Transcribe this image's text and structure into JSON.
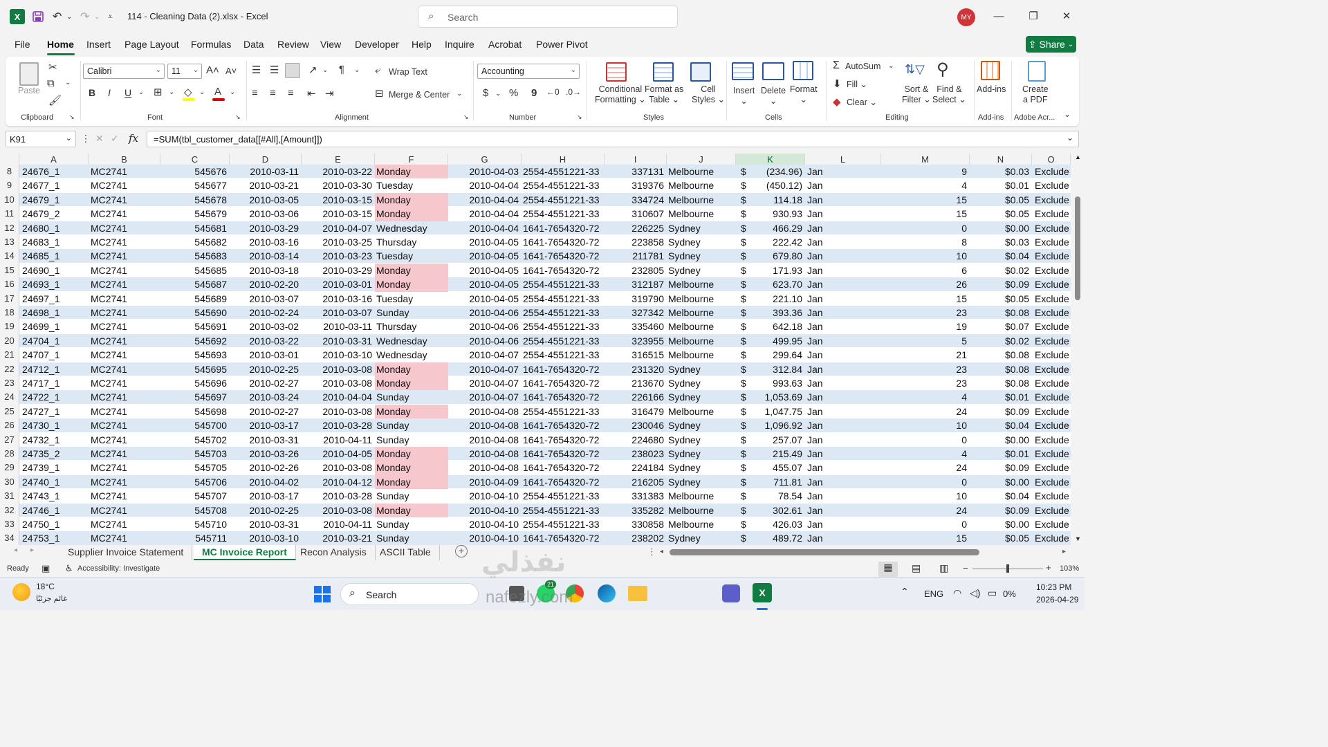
{
  "app": {
    "file_title": "114 - Cleaning Data (2).xlsx  -  Excel",
    "search_placeholder": "Search",
    "avatar": "MY",
    "logo": "X"
  },
  "menu_tabs": [
    "File",
    "Home",
    "Insert",
    "Page Layout",
    "Formulas",
    "Data",
    "Review",
    "View",
    "Developer",
    "Help",
    "Inquire",
    "Acrobat",
    "Power Pivot"
  ],
  "share_label": "Share",
  "ribbon": {
    "clipboard": {
      "label": "Clipboard",
      "paste": "Paste"
    },
    "font": {
      "label": "Font",
      "name": "Calibri",
      "size": "11",
      "bold": "B",
      "italic": "I",
      "underline": "U"
    },
    "alignment": {
      "label": "Alignment",
      "wrap": "Wrap Text",
      "merge": "Merge & Center"
    },
    "number": {
      "label": "Number",
      "format": "Accounting",
      "dollar": "$",
      "percent": "%",
      "comma": "9"
    },
    "styles": {
      "label": "Styles",
      "conditional_1": "Conditional",
      "conditional_2": "Formatting",
      "format_table_1": "Format as",
      "format_table_2": "Table",
      "cell_styles_1": "Cell",
      "cell_styles_2": "Styles"
    },
    "cells": {
      "label": "Cells",
      "insert": "Insert",
      "delete": "Delete",
      "format": "Format"
    },
    "editing": {
      "label": "Editing",
      "autosum": "AutoSum",
      "fill": "Fill",
      "clear": "Clear",
      "sort_1": "Sort &",
      "sort_2": "Filter",
      "find_1": "Find &",
      "find_2": "Select"
    },
    "addins": {
      "label": "Add-ins",
      "btn": "Add-ins"
    },
    "adobe": {
      "label": "Adobe Acr...",
      "btn_1": "Create",
      "btn_2": "a PDF"
    }
  },
  "formula_bar": {
    "name_box": "K91",
    "fx": "fx",
    "formula": "=SUM(tbl_customer_data[[#All],[Amount]])"
  },
  "columns": [
    "A",
    "B",
    "C",
    "D",
    "E",
    "F",
    "G",
    "H",
    "I",
    "J",
    "K",
    "L",
    "M",
    "N",
    "O"
  ],
  "selected_column": "K",
  "rows": [
    {
      "n": "8",
      "a": "24676_1",
      "b": "MC2741",
      "c": "545676",
      "d": "2010-03-11",
      "e": "2010-03-22",
      "f": "Monday",
      "g": "2010-04-03",
      "h": "2554-4551221-33",
      "i": "337131",
      "j": "Melbourne",
      "ks": "$",
      "k": "(234.96)",
      "l": "Jan",
      "m": "9",
      "nn": "$0.03",
      "o": "Exclude"
    },
    {
      "n": "9",
      "a": "24677_1",
      "b": "MC2741",
      "c": "545677",
      "d": "2010-03-21",
      "e": "2010-03-30",
      "f": "Tuesday",
      "g": "2010-04-04",
      "h": "2554-4551221-33",
      "i": "319376",
      "j": "Melbourne",
      "ks": "$",
      "k": "(450.12)",
      "l": "Jan",
      "m": "4",
      "nn": "$0.01",
      "o": "Exclude"
    },
    {
      "n": "10",
      "a": "24679_1",
      "b": "MC2741",
      "c": "545678",
      "d": "2010-03-05",
      "e": "2010-03-15",
      "f": "Monday",
      "g": "2010-04-04",
      "h": "2554-4551221-33",
      "i": "334724",
      "j": "Melbourne",
      "ks": "$",
      "k": "114.18",
      "l": "Jan",
      "m": "15",
      "nn": "$0.05",
      "o": "Exclude"
    },
    {
      "n": "11",
      "a": "24679_2",
      "b": "MC2741",
      "c": "545679",
      "d": "2010-03-06",
      "e": "2010-03-15",
      "f": "Monday",
      "g": "2010-04-04",
      "h": "2554-4551221-33",
      "i": "310607",
      "j": "Melbourne",
      "ks": "$",
      "k": "930.93",
      "l": "Jan",
      "m": "15",
      "nn": "$0.05",
      "o": "Exclude"
    },
    {
      "n": "12",
      "a": "24680_1",
      "b": "MC2741",
      "c": "545681",
      "d": "2010-03-29",
      "e": "2010-04-07",
      "f": "Wednesday",
      "g": "2010-04-04",
      "h": "1641-7654320-72",
      "i": "226225",
      "j": "Sydney",
      "ks": "$",
      "k": "466.29",
      "l": "Jan",
      "m": "0",
      "nn": "$0.00",
      "o": "Exclude"
    },
    {
      "n": "13",
      "a": "24683_1",
      "b": "MC2741",
      "c": "545682",
      "d": "2010-03-16",
      "e": "2010-03-25",
      "f": "Thursday",
      "g": "2010-04-05",
      "h": "1641-7654320-72",
      "i": "223858",
      "j": "Sydney",
      "ks": "$",
      "k": "222.42",
      "l": "Jan",
      "m": "8",
      "nn": "$0.03",
      "o": "Exclude"
    },
    {
      "n": "14",
      "a": "24685_1",
      "b": "MC2741",
      "c": "545683",
      "d": "2010-03-14",
      "e": "2010-03-23",
      "f": "Tuesday",
      "g": "2010-04-05",
      "h": "1641-7654320-72",
      "i": "211781",
      "j": "Sydney",
      "ks": "$",
      "k": "679.80",
      "l": "Jan",
      "m": "10",
      "nn": "$0.04",
      "o": "Exclude"
    },
    {
      "n": "15",
      "a": "24690_1",
      "b": "MC2741",
      "c": "545685",
      "d": "2010-03-18",
      "e": "2010-03-29",
      "f": "Monday",
      "g": "2010-04-05",
      "h": "1641-7654320-72",
      "i": "232805",
      "j": "Sydney",
      "ks": "$",
      "k": "171.93",
      "l": "Jan",
      "m": "6",
      "nn": "$0.02",
      "o": "Exclude"
    },
    {
      "n": "16",
      "a": "24693_1",
      "b": "MC2741",
      "c": "545687",
      "d": "2010-02-20",
      "e": "2010-03-01",
      "f": "Monday",
      "g": "2010-04-05",
      "h": "2554-4551221-33",
      "i": "312187",
      "j": "Melbourne",
      "ks": "$",
      "k": "623.70",
      "l": "Jan",
      "m": "26",
      "nn": "$0.09",
      "o": "Exclude"
    },
    {
      "n": "17",
      "a": "24697_1",
      "b": "MC2741",
      "c": "545689",
      "d": "2010-03-07",
      "e": "2010-03-16",
      "f": "Tuesday",
      "g": "2010-04-05",
      "h": "2554-4551221-33",
      "i": "319790",
      "j": "Melbourne",
      "ks": "$",
      "k": "221.10",
      "l": "Jan",
      "m": "15",
      "nn": "$0.05",
      "o": "Exclude"
    },
    {
      "n": "18",
      "a": "24698_1",
      "b": "MC2741",
      "c": "545690",
      "d": "2010-02-24",
      "e": "2010-03-07",
      "f": "Sunday",
      "g": "2010-04-06",
      "h": "2554-4551221-33",
      "i": "327342",
      "j": "Melbourne",
      "ks": "$",
      "k": "393.36",
      "l": "Jan",
      "m": "23",
      "nn": "$0.08",
      "o": "Exclude"
    },
    {
      "n": "19",
      "a": "24699_1",
      "b": "MC2741",
      "c": "545691",
      "d": "2010-03-02",
      "e": "2010-03-11",
      "f": "Thursday",
      "g": "2010-04-06",
      "h": "2554-4551221-33",
      "i": "335460",
      "j": "Melbourne",
      "ks": "$",
      "k": "642.18",
      "l": "Jan",
      "m": "19",
      "nn": "$0.07",
      "o": "Exclude"
    },
    {
      "n": "20",
      "a": "24704_1",
      "b": "MC2741",
      "c": "545692",
      "d": "2010-03-22",
      "e": "2010-03-31",
      "f": "Wednesday",
      "g": "2010-04-06",
      "h": "2554-4551221-33",
      "i": "323955",
      "j": "Melbourne",
      "ks": "$",
      "k": "499.95",
      "l": "Jan",
      "m": "5",
      "nn": "$0.02",
      "o": "Exclude"
    },
    {
      "n": "21",
      "a": "24707_1",
      "b": "MC2741",
      "c": "545693",
      "d": "2010-03-01",
      "e": "2010-03-10",
      "f": "Wednesday",
      "g": "2010-04-07",
      "h": "2554-4551221-33",
      "i": "316515",
      "j": "Melbourne",
      "ks": "$",
      "k": "299.64",
      "l": "Jan",
      "m": "21",
      "nn": "$0.08",
      "o": "Exclude"
    },
    {
      "n": "22",
      "a": "24712_1",
      "b": "MC2741",
      "c": "545695",
      "d": "2010-02-25",
      "e": "2010-03-08",
      "f": "Monday",
      "g": "2010-04-07",
      "h": "1641-7654320-72",
      "i": "231320",
      "j": "Sydney",
      "ks": "$",
      "k": "312.84",
      "l": "Jan",
      "m": "23",
      "nn": "$0.08",
      "o": "Exclude"
    },
    {
      "n": "23",
      "a": "24717_1",
      "b": "MC2741",
      "c": "545696",
      "d": "2010-02-27",
      "e": "2010-03-08",
      "f": "Monday",
      "g": "2010-04-07",
      "h": "1641-7654320-72",
      "i": "213670",
      "j": "Sydney",
      "ks": "$",
      "k": "993.63",
      "l": "Jan",
      "m": "23",
      "nn": "$0.08",
      "o": "Exclude"
    },
    {
      "n": "24",
      "a": "24722_1",
      "b": "MC2741",
      "c": "545697",
      "d": "2010-03-24",
      "e": "2010-04-04",
      "f": "Sunday",
      "g": "2010-04-07",
      "h": "1641-7654320-72",
      "i": "226166",
      "j": "Sydney",
      "ks": "$",
      "k": "1,053.69",
      "l": "Jan",
      "m": "4",
      "nn": "$0.01",
      "o": "Exclude"
    },
    {
      "n": "25",
      "a": "24727_1",
      "b": "MC2741",
      "c": "545698",
      "d": "2010-02-27",
      "e": "2010-03-08",
      "f": "Monday",
      "g": "2010-04-08",
      "h": "2554-4551221-33",
      "i": "316479",
      "j": "Melbourne",
      "ks": "$",
      "k": "1,047.75",
      "l": "Jan",
      "m": "24",
      "nn": "$0.09",
      "o": "Exclude"
    },
    {
      "n": "26",
      "a": "24730_1",
      "b": "MC2741",
      "c": "545700",
      "d": "2010-03-17",
      "e": "2010-03-28",
      "f": "Sunday",
      "g": "2010-04-08",
      "h": "1641-7654320-72",
      "i": "230046",
      "j": "Sydney",
      "ks": "$",
      "k": "1,096.92",
      "l": "Jan",
      "m": "10",
      "nn": "$0.04",
      "o": "Exclude"
    },
    {
      "n": "27",
      "a": "24732_1",
      "b": "MC2741",
      "c": "545702",
      "d": "2010-03-31",
      "e": "2010-04-11",
      "f": "Sunday",
      "g": "2010-04-08",
      "h": "1641-7654320-72",
      "i": "224680",
      "j": "Sydney",
      "ks": "$",
      "k": "257.07",
      "l": "Jan",
      "m": "0",
      "nn": "$0.00",
      "o": "Exclude"
    },
    {
      "n": "28",
      "a": "24735_2",
      "b": "MC2741",
      "c": "545703",
      "d": "2010-03-26",
      "e": "2010-04-05",
      "f": "Monday",
      "g": "2010-04-08",
      "h": "1641-7654320-72",
      "i": "238023",
      "j": "Sydney",
      "ks": "$",
      "k": "215.49",
      "l": "Jan",
      "m": "4",
      "nn": "$0.01",
      "o": "Exclude"
    },
    {
      "n": "29",
      "a": "24739_1",
      "b": "MC2741",
      "c": "545705",
      "d": "2010-02-26",
      "e": "2010-03-08",
      "f": "Monday",
      "g": "2010-04-08",
      "h": "1641-7654320-72",
      "i": "224184",
      "j": "Sydney",
      "ks": "$",
      "k": "455.07",
      "l": "Jan",
      "m": "24",
      "nn": "$0.09",
      "o": "Exclude"
    },
    {
      "n": "30",
      "a": "24740_1",
      "b": "MC2741",
      "c": "545706",
      "d": "2010-04-02",
      "e": "2010-04-12",
      "f": "Monday",
      "g": "2010-04-09",
      "h": "1641-7654320-72",
      "i": "216205",
      "j": "Sydney",
      "ks": "$",
      "k": "711.81",
      "l": "Jan",
      "m": "0",
      "nn": "$0.00",
      "o": "Exclude"
    },
    {
      "n": "31",
      "a": "24743_1",
      "b": "MC2741",
      "c": "545707",
      "d": "2010-03-17",
      "e": "2010-03-28",
      "f": "Sunday",
      "g": "2010-04-10",
      "h": "2554-4551221-33",
      "i": "331383",
      "j": "Melbourne",
      "ks": "$",
      "k": "78.54",
      "l": "Jan",
      "m": "10",
      "nn": "$0.04",
      "o": "Exclude"
    },
    {
      "n": "32",
      "a": "24746_1",
      "b": "MC2741",
      "c": "545708",
      "d": "2010-02-25",
      "e": "2010-03-08",
      "f": "Monday",
      "g": "2010-04-10",
      "h": "2554-4551221-33",
      "i": "335282",
      "j": "Melbourne",
      "ks": "$",
      "k": "302.61",
      "l": "Jan",
      "m": "24",
      "nn": "$0.09",
      "o": "Exclude"
    },
    {
      "n": "33",
      "a": "24750_1",
      "b": "MC2741",
      "c": "545710",
      "d": "2010-03-31",
      "e": "2010-04-11",
      "f": "Sunday",
      "g": "2010-04-10",
      "h": "2554-4551221-33",
      "i": "330858",
      "j": "Melbourne",
      "ks": "$",
      "k": "426.03",
      "l": "Jan",
      "m": "0",
      "nn": "$0.00",
      "o": "Exclude"
    },
    {
      "n": "34",
      "a": "24753_1",
      "b": "MC2741",
      "c": "545711",
      "d": "2010-03-10",
      "e": "2010-03-21",
      "f": "Sunday",
      "g": "2010-04-10",
      "h": "1641-7654320-72",
      "i": "238202",
      "j": "Sydney",
      "ks": "$",
      "k": "489.72",
      "l": "Jan",
      "m": "15",
      "nn": "$0.05",
      "o": "Exclude"
    }
  ],
  "sheet_tabs": [
    "Supplier Invoice Statement",
    "MC Invoice Report",
    "Recon Analysis",
    "ASCII Table"
  ],
  "active_sheet": "MC Invoice Report",
  "status": {
    "ready": "Ready",
    "accessibility": "Accessibility: Investigate",
    "zoom": "103%"
  },
  "taskbar": {
    "temp": "18°C",
    "weather_desc": "غائم جزئيًا",
    "search": "Search",
    "badge": "21",
    "lang": "ENG",
    "battery": "0%",
    "time": "10:23 PM",
    "date": "2026-04-29"
  },
  "watermark": {
    "top": "نفذلي",
    "bottom": "nafezly.com"
  },
  "colors": {
    "excel_green": "#107c41",
    "band_blue": "#dde8f5",
    "monday_red": "#f7c7ce"
  }
}
